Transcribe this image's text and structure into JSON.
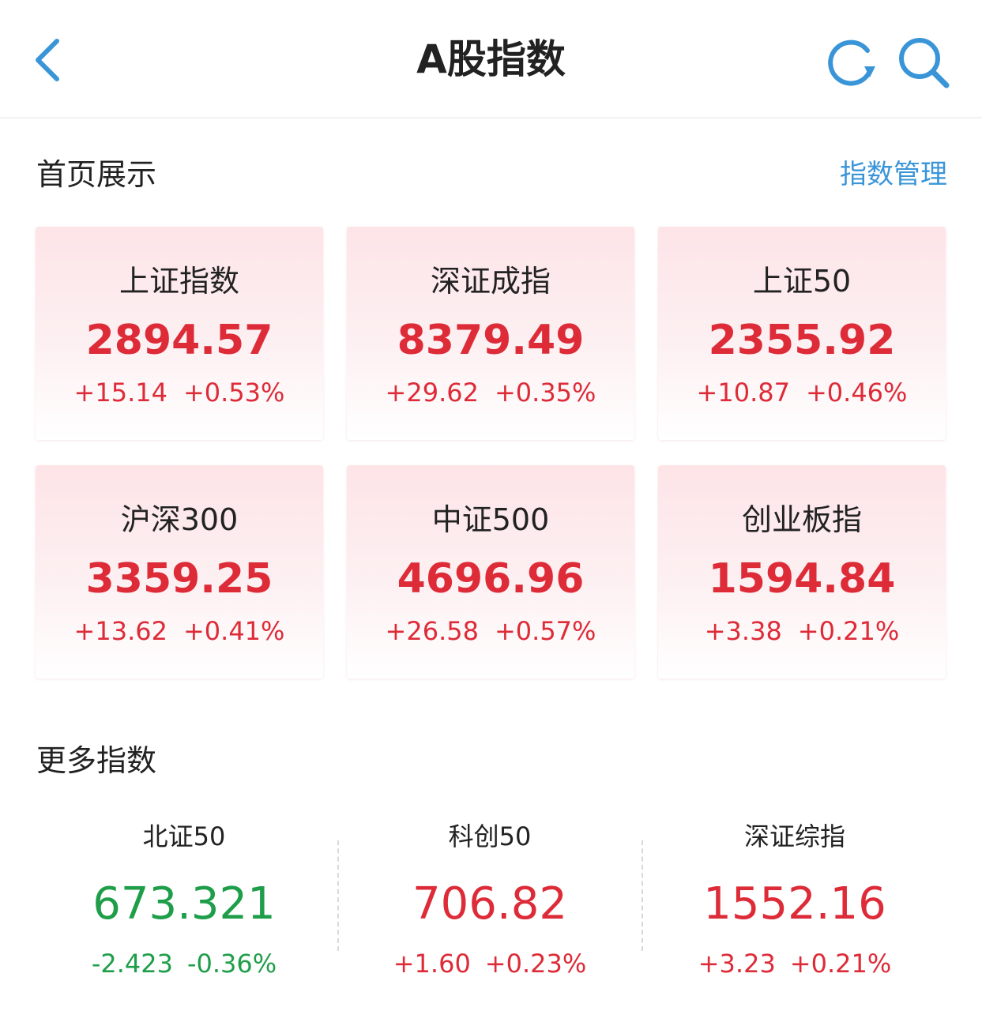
{
  "header": {
    "title": "A股指数",
    "back_icon": "chevron-left-icon",
    "refresh_icon": "refresh-icon",
    "search_icon": "search-icon"
  },
  "featured": {
    "title": "首页展示",
    "manage_label": "指数管理",
    "cards": [
      {
        "name": "上证指数",
        "value": "2894.57",
        "change": "+15.14",
        "percent": "+0.53%"
      },
      {
        "name": "深证成指",
        "value": "8379.49",
        "change": "+29.62",
        "percent": "+0.35%"
      },
      {
        "name": "上证50",
        "value": "2355.92",
        "change": "+10.87",
        "percent": "+0.46%"
      },
      {
        "name": "沪深300",
        "value": "3359.25",
        "change": "+13.62",
        "percent": "+0.41%"
      },
      {
        "name": "中证500",
        "value": "4696.96",
        "change": "+26.58",
        "percent": "+0.57%"
      },
      {
        "name": "创业板指",
        "value": "1594.84",
        "change": "+3.38",
        "percent": "+0.21%"
      }
    ]
  },
  "more": {
    "title": "更多指数",
    "items": [
      {
        "name": "北证50",
        "value": "673.321",
        "change": "-2.423",
        "percent": "-0.36%",
        "trend": "down"
      },
      {
        "name": "科创50",
        "value": "706.82",
        "change": "+1.60",
        "percent": "+0.23%",
        "trend": "up"
      },
      {
        "name": "深证综指",
        "value": "1552.16",
        "change": "+3.23",
        "percent": "+0.21%",
        "trend": "up"
      }
    ]
  },
  "colors": {
    "up": "#dd2b38",
    "down": "#1f9e4a",
    "accent": "#3a95d8",
    "card_top": "#fde4e7"
  }
}
